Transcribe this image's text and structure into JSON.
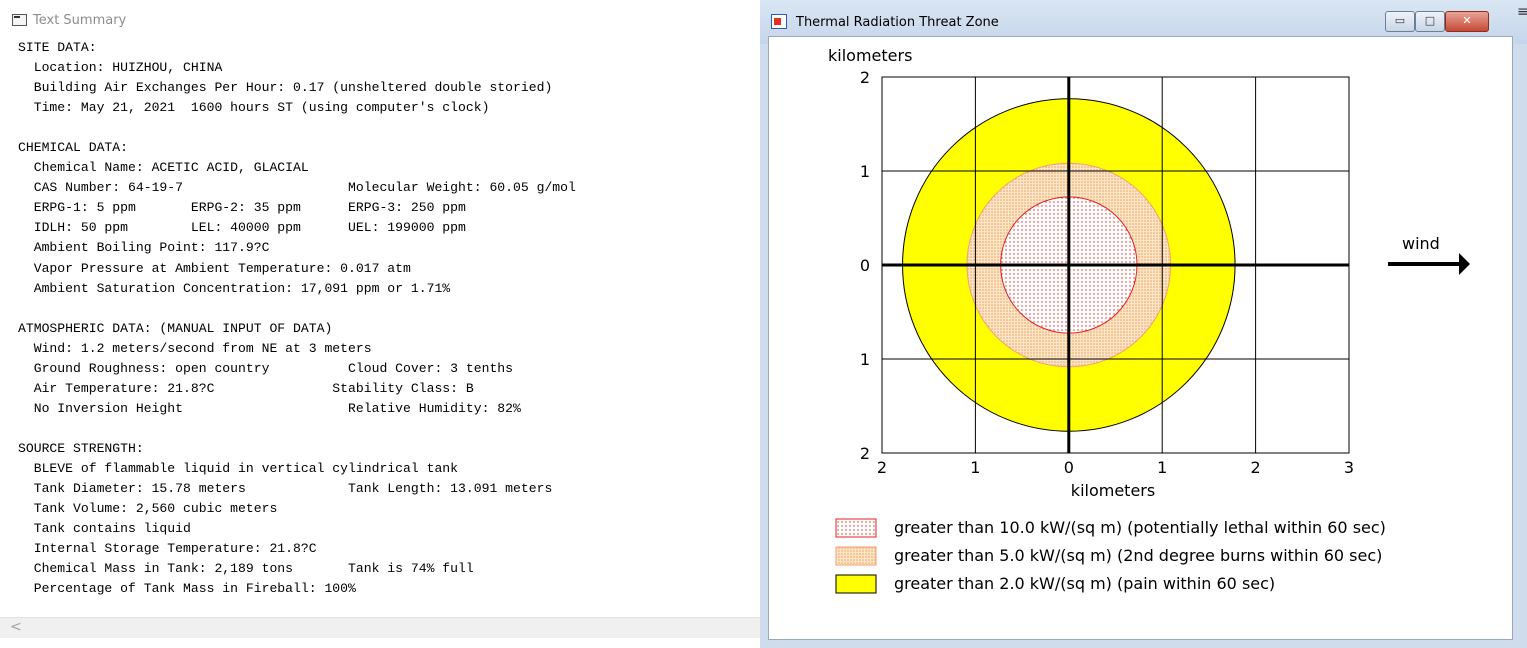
{
  "summary_window": {
    "title": "Text Summary",
    "lines": [
      "SITE DATA:",
      "  Location: HUIZHOU, CHINA",
      "  Building Air Exchanges Per Hour: 0.17 (unsheltered double storied)",
      "  Time: May 21, 2021  1600 hours ST (using computer's clock)",
      "",
      "CHEMICAL DATA:",
      "  Chemical Name: ACETIC ACID, GLACIAL",
      "  CAS Number: 64-19-7                     Molecular Weight: 60.05 g/mol",
      "  ERPG-1: 5 ppm       ERPG-2: 35 ppm      ERPG-3: 250 ppm",
      "  IDLH: 50 ppm        LEL: 40000 ppm      UEL: 199000 ppm",
      "  Ambient Boiling Point: 117.9?C",
      "  Vapor Pressure at Ambient Temperature: 0.017 atm",
      "  Ambient Saturation Concentration: 17,091 ppm or 1.71%",
      "",
      "ATMOSPHERIC DATA: (MANUAL INPUT OF DATA)",
      "  Wind: 1.2 meters/second from NE at 3 meters",
      "  Ground Roughness: open country          Cloud Cover: 3 tenths",
      "  Air Temperature: 21.8?C               Stability Class: B",
      "  No Inversion Height                     Relative Humidity: 82%",
      "",
      "SOURCE STRENGTH:",
      "  BLEVE of flammable liquid in vertical cylindrical tank",
      "  Tank Diameter: 15.78 meters             Tank Length: 13.091 meters",
      "  Tank Volume: 2,560 cubic meters",
      "  Tank contains liquid",
      "  Internal Storage Temperature: 21.8?C",
      "  Chemical Mass in Tank: 2,189 tons       Tank is 74% full",
      "  Percentage of Tank Mass in Fireball: 100%"
    ],
    "scroll_left_glyph": "<"
  },
  "threat_window": {
    "title": "Thermal Radiation Threat Zone",
    "min_glyph": "▭",
    "max_glyph": "□",
    "close_glyph": "✕",
    "side_glyph": "≡"
  },
  "chart_data": {
    "type": "threat-zone",
    "ylabel": "kilometers",
    "xlabel": "kilometers",
    "x_ticks": [
      "2",
      "1",
      "0",
      "1",
      "2",
      "3"
    ],
    "x_tick_values": [
      -2,
      -1,
      0,
      1,
      2,
      3
    ],
    "y_ticks": [
      "2",
      "1",
      "0",
      "1",
      "2"
    ],
    "y_tick_values": [
      2,
      1,
      0,
      -1,
      -2
    ],
    "xlim": [
      -2,
      3
    ],
    "ylim": [
      -2,
      2
    ],
    "grid": true,
    "wind_label": "wind",
    "zones": [
      {
        "label": "greater than 2.0 kW/(sq m) (pain within 60 sec)",
        "radius_km": 1.78,
        "fill": "#ffff00",
        "stroke": "#000000",
        "pattern": "solid"
      },
      {
        "label": "greater than 5.0 kW/(sq m) (2nd degree burns within 60 sec)",
        "radius_km": 1.09,
        "fill": "#f8dcb0",
        "stroke": "#f4a070",
        "pattern": "dots-orange"
      },
      {
        "label": "greater than 10.0 kW/(sq m) (potentially lethal within 60 sec)",
        "radius_km": 0.73,
        "fill": "#ffffff",
        "stroke": "#e02020",
        "pattern": "dots-red"
      }
    ],
    "legend_order": [
      2,
      1,
      0
    ]
  }
}
